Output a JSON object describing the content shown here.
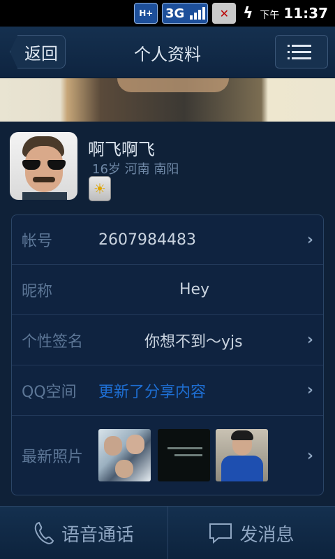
{
  "status_bar": {
    "network_badge": "H+",
    "network_type": "3G",
    "ampm": "下午",
    "time": "11:37"
  },
  "header": {
    "back_label": "返回",
    "title": "个人资料"
  },
  "profile": {
    "nickname": "啊飞啊飞",
    "details": "16岁 河南 南阳"
  },
  "info_rows": [
    {
      "label": "帐号",
      "value": "2607984483"
    },
    {
      "label": "昵称",
      "value": "Hey"
    },
    {
      "label": "个性签名",
      "value": "你想不到～yjs"
    },
    {
      "label": "QQ空间",
      "value": "更新了分享内容"
    },
    {
      "label": "最新照片",
      "value": ""
    }
  ],
  "bottom_bar": {
    "voice_call_label": "语音通话",
    "message_label": "发消息"
  },
  "colors": {
    "background": "#0f2138",
    "link": "#1e6ed2",
    "label": "#5c7696"
  }
}
